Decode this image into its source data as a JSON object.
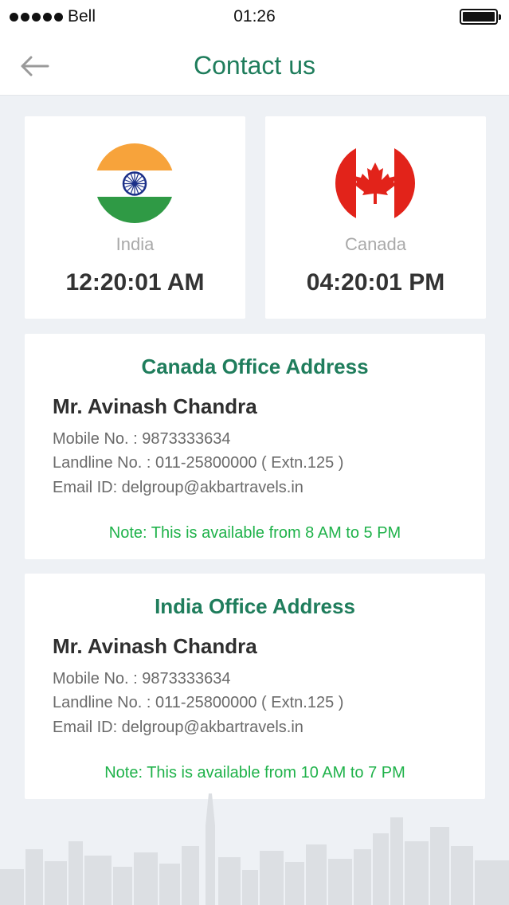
{
  "status_bar": {
    "carrier": "Bell",
    "time": "01:26",
    "signal_icon": "signal-dots-icon",
    "battery_icon": "battery-full-icon",
    "battery_level": 1.0
  },
  "nav": {
    "title": "Contact us",
    "back_icon": "arrow-left-icon"
  },
  "clocks": [
    {
      "country": "India",
      "time": "12:20:01 AM",
      "flag_icon": "india-flag-icon"
    },
    {
      "country": "Canada",
      "time": "04:20:01 PM",
      "flag_icon": "canada-flag-icon"
    }
  ],
  "offices": [
    {
      "title": "Canada Office Address",
      "contact_name": "Mr. Avinash Chandra",
      "mobile": "Mobile No. : 9873333634",
      "landline": "Landline No. : 011-25800000 ( Extn.125 )",
      "email": "Email ID: delgroup@akbartravels.in",
      "note": "Note: This is available from 8 AM to 5 PM"
    },
    {
      "title": "India Office Address",
      "contact_name": "Mr. Avinash Chandra",
      "mobile": "Mobile No. : 9873333634",
      "landline": "Landline No. : 011-25800000 ( Extn.125 )",
      "email": "Email ID: delgroup@akbartravels.in",
      "note": "Note: This is available from 10 AM to 7 PM"
    }
  ],
  "colors": {
    "brand_green": "#1f7d5c",
    "note_green": "#1fb24a",
    "background": "#eef1f5",
    "india_saffron": "#f7a33b",
    "india_green": "#2f9a45",
    "canada_red": "#e2231a"
  },
  "decoration": {
    "skyline_icon": "city-skyline-icon"
  }
}
